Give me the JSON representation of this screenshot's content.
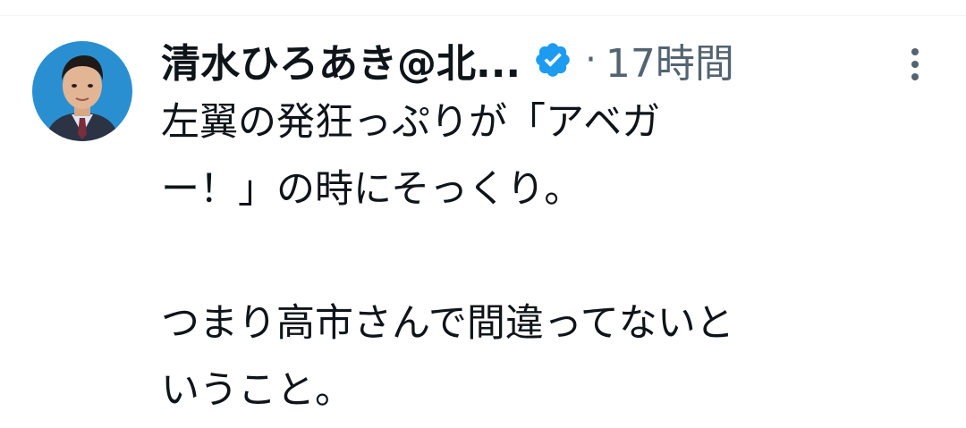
{
  "tweet": {
    "display_name": "清水ひろあき@北...",
    "separator": "·",
    "timestamp": "17時間",
    "verified": true,
    "more_icon": "more-vertical-icon",
    "avatar_icon": "profile-photo",
    "text_lines": [
      "左翼の発狂っぷりが「アベガ",
      "ー！」の時にそっくり。",
      "",
      "つまり高市さんで間違ってないと",
      "いうこと。"
    ]
  },
  "colors": {
    "text": "#0f1419",
    "secondary": "#536471",
    "verified": "#1d9bf0",
    "avatar_bg": "#2a8fd0"
  }
}
